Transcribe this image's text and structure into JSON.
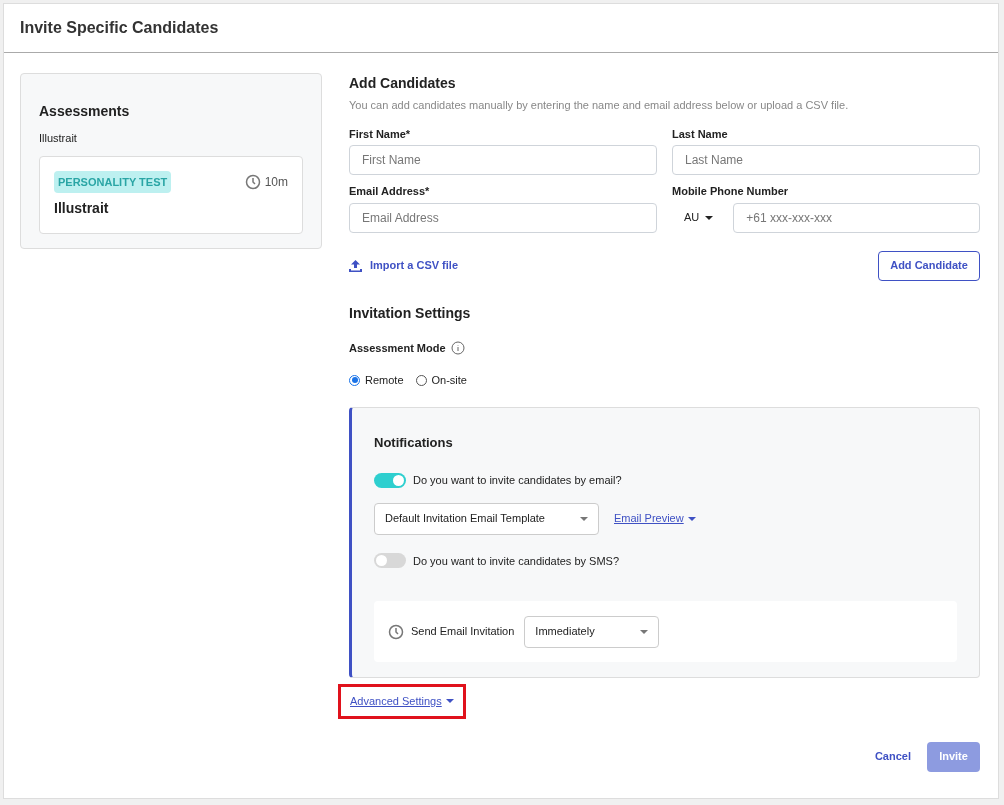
{
  "dialog": {
    "title": "Invite Specific Candidates"
  },
  "assessments": {
    "heading": "Assessments",
    "group": "Illustrait",
    "card": {
      "tag": "PERSONALITY TEST",
      "duration": "10m",
      "name": "Illustrait"
    }
  },
  "add_candidates": {
    "heading": "Add Candidates",
    "description": "You can add candidates manually by entering the name and email address below or upload a CSV file.",
    "fields": [
      {
        "label": "First Name*",
        "placeholder": "First Name"
      },
      {
        "label": "Last Name",
        "placeholder": "Last Name"
      },
      {
        "label": "Email Address*",
        "placeholder": "Email Address"
      }
    ],
    "phone": {
      "label": "Mobile Phone Number",
      "country": "AU",
      "placeholder": "+61 xxx-xxx-xxx"
    },
    "import_link": "Import a CSV file",
    "add_button": "Add Candidate"
  },
  "invitation_settings": {
    "heading": "Invitation Settings",
    "mode_label": "Assessment Mode",
    "modes": [
      {
        "label": "Remote",
        "selected": true
      },
      {
        "label": "On-site",
        "selected": false
      }
    ]
  },
  "notifications": {
    "heading": "Notifications",
    "toggles": [
      {
        "label": "Do you want to invite candidates by email?",
        "on": true
      },
      {
        "label": "Do you want to invite candidates by SMS?",
        "on": false
      }
    ],
    "template": "Default Invitation Email Template",
    "preview_link": "Email Preview",
    "send_label": "Send Email Invitation",
    "send_value": "Immediately"
  },
  "advanced_settings": {
    "label": "Advanced Settings",
    "highlighted": true
  },
  "footer": {
    "cancel": "Cancel",
    "invite": "Invite",
    "invite_disabled": true
  }
}
